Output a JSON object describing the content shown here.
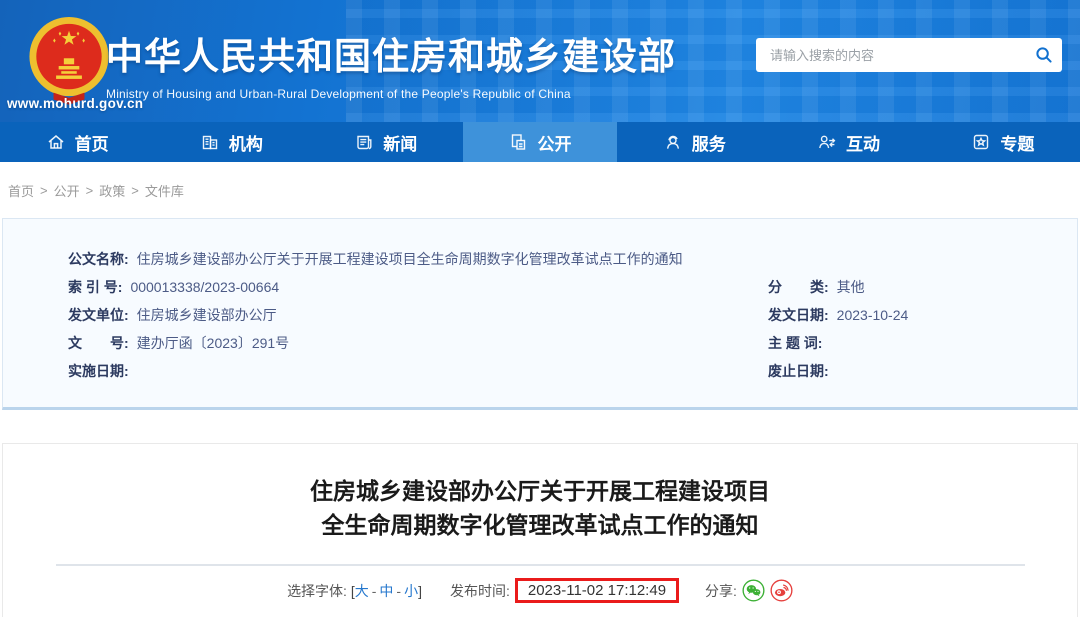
{
  "header": {
    "site_url": "www.mohurd.gov.cn",
    "title": "中华人民共和国住房和城乡建设部",
    "subtitle": "Ministry of Housing and Urban-Rural Development of the People's Republic of China",
    "search": {
      "placeholder": "请输入搜索的内容",
      "icon": "search-icon"
    }
  },
  "nav": {
    "items": [
      {
        "label": "首页",
        "icon": "home-icon",
        "active": false
      },
      {
        "label": "机构",
        "icon": "organization-icon",
        "active": false
      },
      {
        "label": "新闻",
        "icon": "news-icon",
        "active": false
      },
      {
        "label": "公开",
        "icon": "disclosure-icon",
        "active": true
      },
      {
        "label": "服务",
        "icon": "service-icon",
        "active": false
      },
      {
        "label": "互动",
        "icon": "interaction-icon",
        "active": false
      },
      {
        "label": "专题",
        "icon": "topics-icon",
        "active": false
      }
    ]
  },
  "breadcrumb": {
    "items": [
      "首页",
      "公开",
      "政策",
      "文件库"
    ],
    "separator": ">"
  },
  "doc_info": {
    "name": {
      "label": "公文名称:",
      "value": "住房城乡建设部办公厅关于开展工程建设项目全生命周期数字化管理改革试点工作的通知"
    },
    "left": [
      {
        "label": "索 引 号:",
        "value": "000013338/2023-00664"
      },
      {
        "label": "发文单位:",
        "value": "住房城乡建设部办公厅"
      },
      {
        "label": "文　　号:",
        "value": "建办厅函〔2023〕291号"
      },
      {
        "label": "实施日期:",
        "value": ""
      }
    ],
    "right": [
      {
        "label": "分　　类:",
        "value": "其他"
      },
      {
        "label": "发文日期:",
        "value": "2023-10-24"
      },
      {
        "label": "主 题 词:",
        "value": ""
      },
      {
        "label": "废止日期:",
        "value": ""
      }
    ]
  },
  "article": {
    "title_line1": "住房城乡建设部办公厅关于开展工程建设项目",
    "title_line2": "全生命周期数字化管理改革试点工作的通知",
    "font_selector": {
      "label": "选择字体:",
      "bracket_open": "[",
      "large": "大",
      "dash": "-",
      "medium": "中",
      "small": "小",
      "bracket_close": "]"
    },
    "publish": {
      "label": "发布时间:",
      "time": "2023-11-02 17:12:49"
    },
    "share": {
      "label": "分享:",
      "icons": [
        "wechat-icon",
        "weibo-icon"
      ]
    }
  },
  "colors": {
    "header_blue": "#1373d2",
    "nav_blue": "#0a63bb",
    "nav_active_blue": "#3e92da",
    "link_blue": "#2577cd",
    "highlight_red": "#ea1b1b",
    "wechat_green": "#3cb035",
    "weibo_red": "#e6403d",
    "emblem_red": "#dd2b1c",
    "emblem_gold": "#eebf2f",
    "doc_box_bg": "#f7fbff"
  }
}
